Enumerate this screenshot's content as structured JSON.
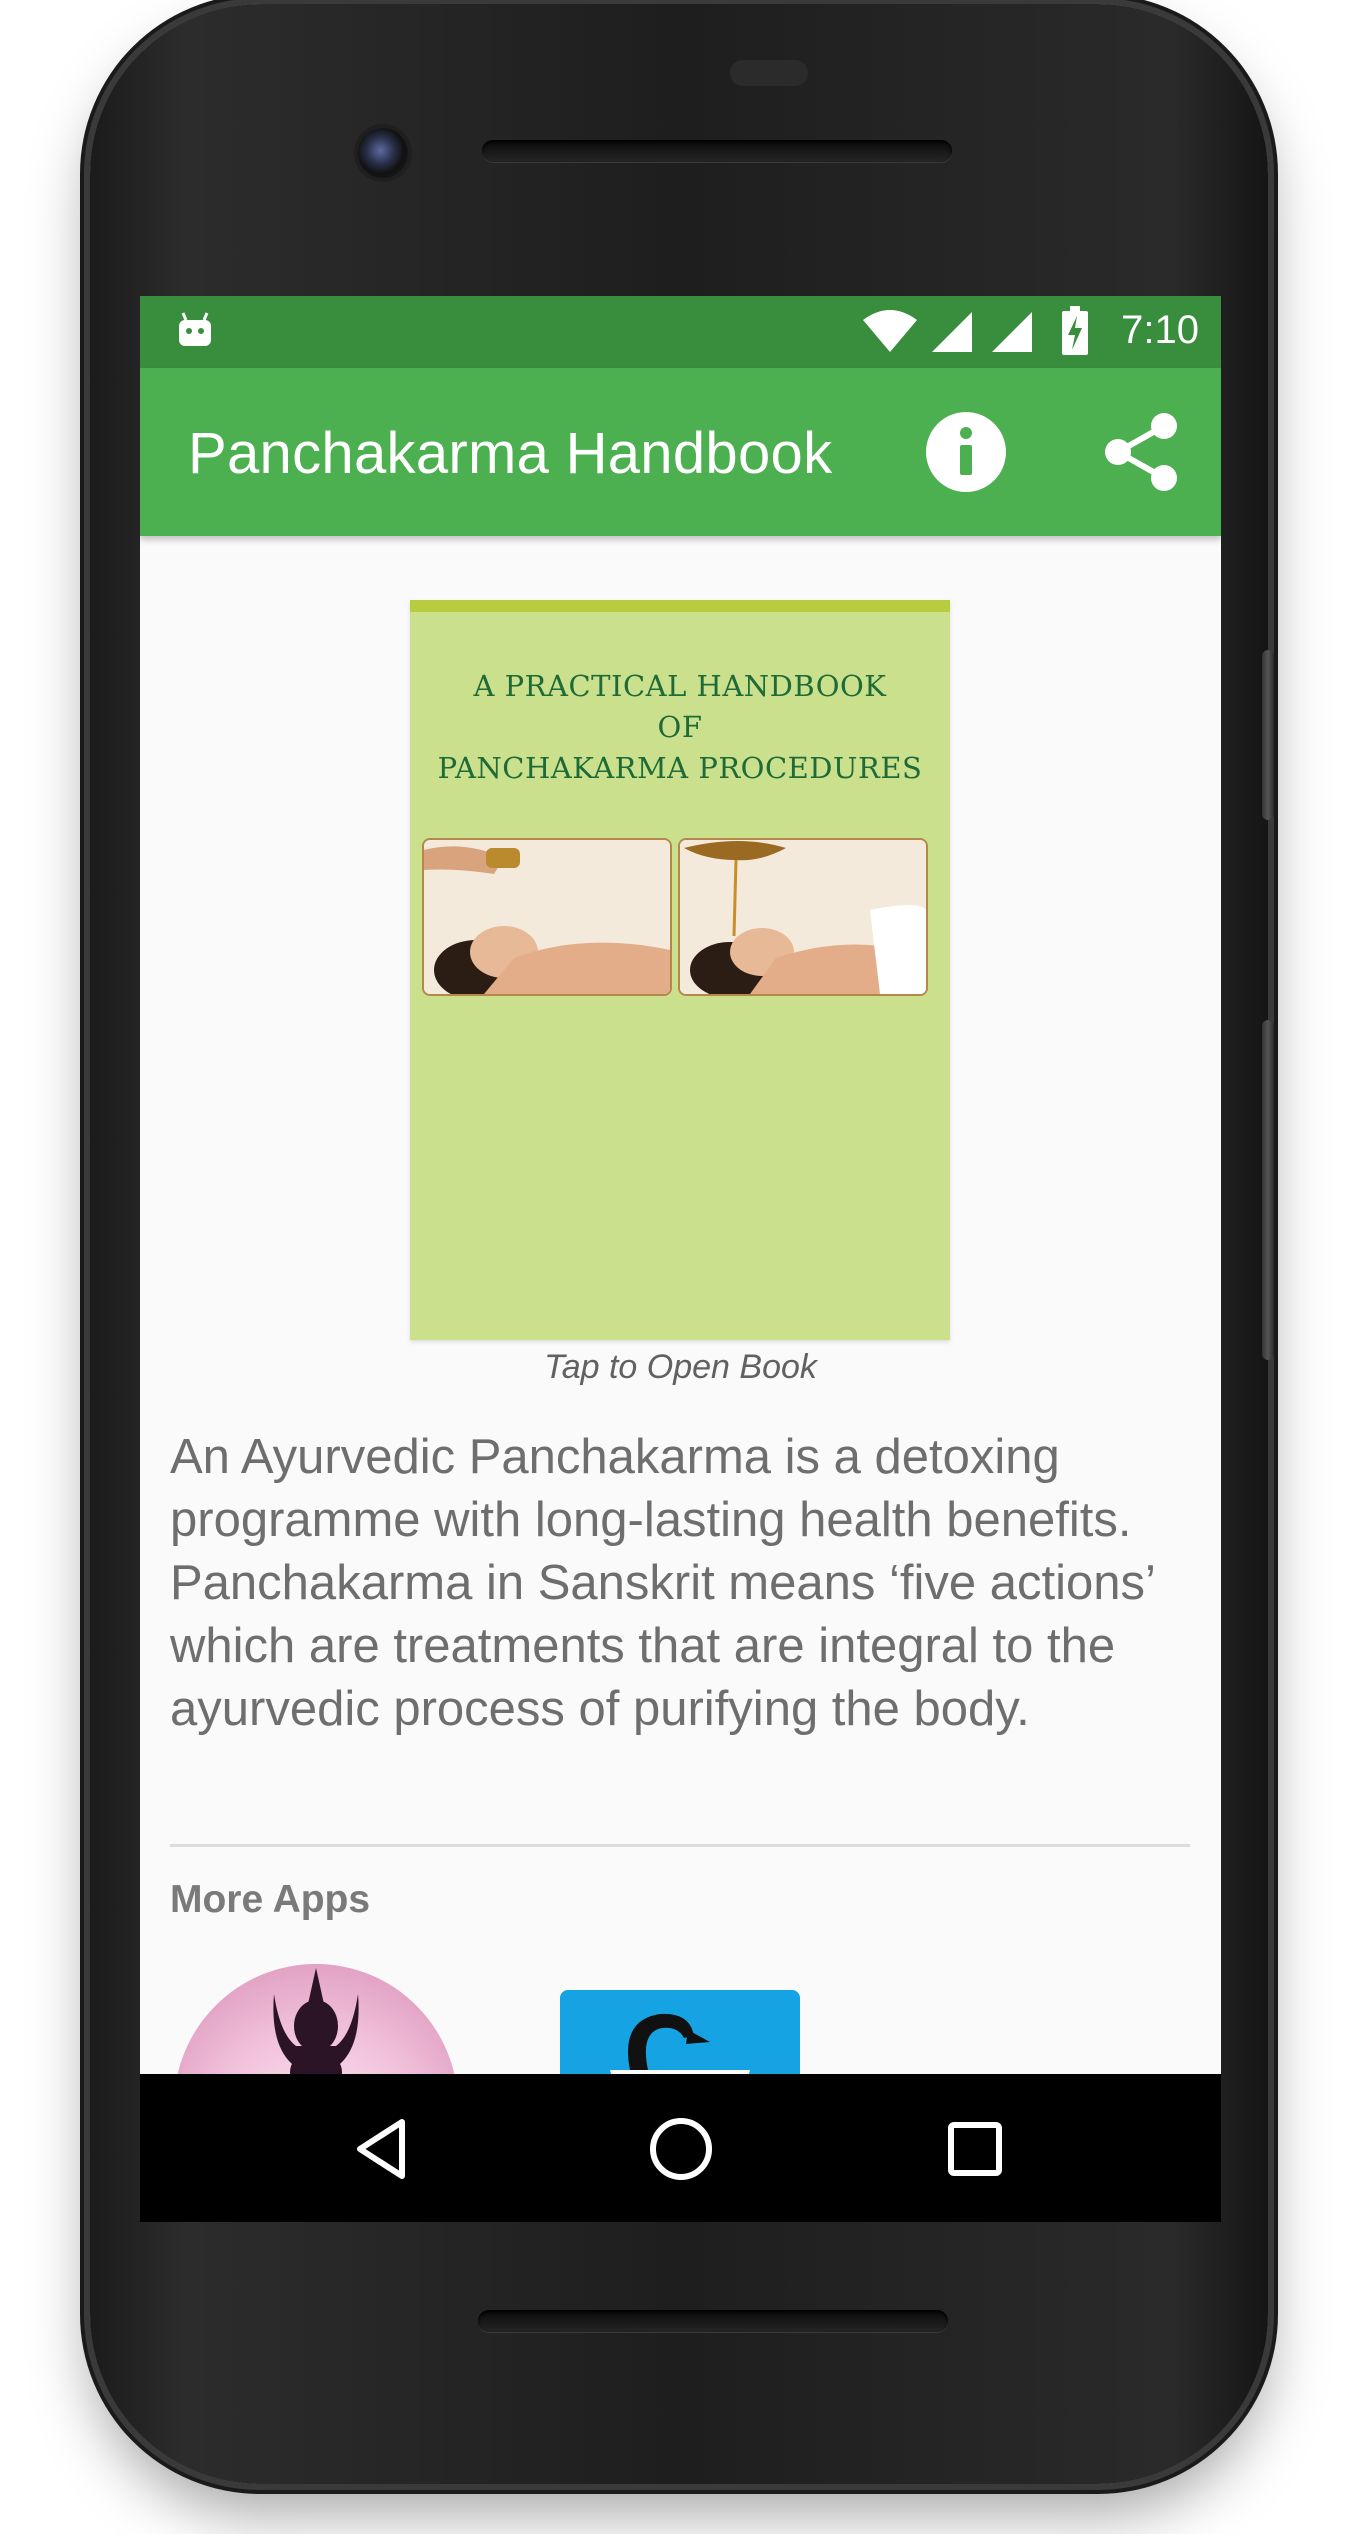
{
  "status_bar": {
    "time": "7:10",
    "icons": [
      "android-debug-icon",
      "wifi-icon",
      "cell-signal-icon",
      "cell-signal-icon",
      "battery-charging-icon"
    ]
  },
  "app_bar": {
    "title": "Panchakarma Handbook",
    "actions": [
      "info-icon",
      "share-icon"
    ],
    "color": "#4caf50",
    "status_color": "#388e3c"
  },
  "book": {
    "cover_title_lines": [
      "A PRACTICAL HANDBOOK",
      "OF",
      "PANCHAKARMA PROCEDURES"
    ],
    "caption": "Tap to Open Book",
    "cover_color": "#cbe08c",
    "title_color": "#1e6b38"
  },
  "description": "An Ayurvedic Panchakarma is a detoxing programme with long-lasting health benefits. Panchakarma in Sanskrit means ‘five actions’ which are treatments that are integral to the ayurvedic process of purifying the body.",
  "more_apps": {
    "heading": "More Apps",
    "apps": [
      {
        "icon": "yoga-pose-icon",
        "color": "#e3a4c6"
      },
      {
        "icon": "swan-icon",
        "color": "#16a3e4"
      }
    ]
  },
  "nav_bar": {
    "buttons": [
      "back-icon",
      "home-icon",
      "recents-icon"
    ]
  }
}
